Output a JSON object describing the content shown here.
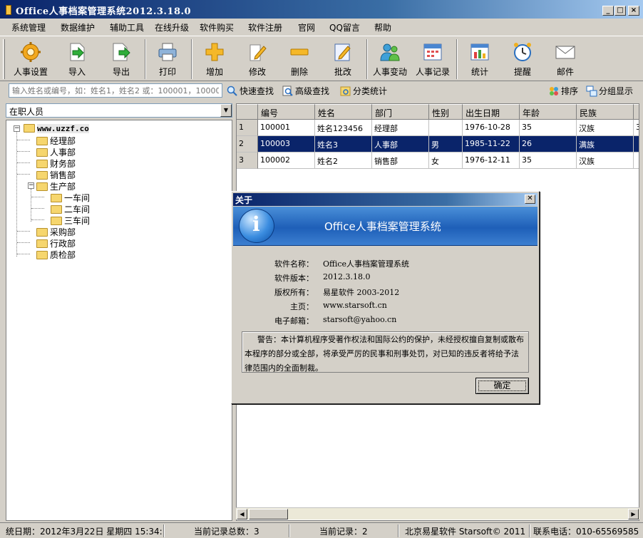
{
  "window": {
    "title": "Office人事档案管理系统2012.3.18.0",
    "controls": {
      "minimize": "_",
      "maximize": "□",
      "close": "×"
    }
  },
  "menu": [
    {
      "id": "system",
      "label": "系统管理"
    },
    {
      "id": "data",
      "label": "数据维护"
    },
    {
      "id": "tools",
      "label": "辅助工具"
    },
    {
      "id": "upgrade",
      "label": "在线升级"
    },
    {
      "id": "buy",
      "label": "软件购买"
    },
    {
      "id": "register",
      "label": "软件注册"
    },
    {
      "id": "site",
      "label": "官网"
    },
    {
      "id": "qq",
      "label": "QQ留言"
    },
    {
      "id": "help",
      "label": "帮助"
    }
  ],
  "toolbar": [
    {
      "id": "settings",
      "label": "人事设置",
      "icon": "gear-icon"
    },
    {
      "id": "import",
      "label": "导入",
      "icon": "import-icon"
    },
    {
      "id": "export",
      "label": "导出",
      "icon": "export-icon"
    },
    {
      "id": "print",
      "label": "打印",
      "icon": "printer-icon"
    },
    {
      "id": "add",
      "label": "增加",
      "icon": "plus-icon"
    },
    {
      "id": "edit",
      "label": "修改",
      "icon": "pencil-icon"
    },
    {
      "id": "delete",
      "label": "删除",
      "icon": "minus-icon"
    },
    {
      "id": "batch",
      "label": "批改",
      "icon": "batch-edit-icon"
    },
    {
      "id": "change",
      "label": "人事变动",
      "icon": "people-icon"
    },
    {
      "id": "record",
      "label": "人事记录",
      "icon": "calendar-icon"
    },
    {
      "id": "stats",
      "label": "统计",
      "icon": "bar-chart-icon"
    },
    {
      "id": "remind",
      "label": "提醒",
      "icon": "alarm-clock-icon"
    },
    {
      "id": "mail",
      "label": "邮件",
      "icon": "envelope-icon"
    }
  ],
  "search": {
    "placeholder": "输入姓名或编号，如：姓名1，姓名2 或：100001，100002",
    "quick": "快速查找",
    "advanced": "高级查找",
    "category": "分类统计",
    "sort": "排序",
    "group": "分组显示"
  },
  "filter": {
    "selected": "在职人员"
  },
  "tree": {
    "root": "www.uzzf.co",
    "departments": [
      "经理部",
      "人事部",
      "财务部",
      "销售部",
      "生产部",
      "一车间",
      "二车间",
      "三车间",
      "采购部",
      "行政部",
      "质检部"
    ]
  },
  "grid": {
    "columns": [
      "编号",
      "姓名",
      "部门",
      "性别",
      "出生日期",
      "年龄",
      "民族"
    ],
    "rows": [
      {
        "n": "1",
        "id": "100001",
        "name": "姓名123456",
        "dept": "经理部",
        "gender": "",
        "birth": "1976-10-28",
        "age": "35",
        "nation": "汉族",
        "extra": "3"
      },
      {
        "n": "2",
        "id": "100003",
        "name": "姓名3",
        "dept": "人事部",
        "gender": "男",
        "birth": "1985-11-22",
        "age": "26",
        "nation": "满族",
        "extra": ""
      },
      {
        "n": "3",
        "id": "100002",
        "name": "姓名2",
        "dept": "销售部",
        "gender": "女",
        "birth": "1976-12-11",
        "age": "35",
        "nation": "汉族",
        "extra": ""
      }
    ],
    "selected_row": 2
  },
  "dialog": {
    "title": "关于",
    "banner_title": "Office人事档案管理系统",
    "info": [
      {
        "key": "软件名称：",
        "value": "Office人事档案管理系统"
      },
      {
        "key": "软件版本：",
        "value": "2012.3.18.0"
      },
      {
        "key": "版权所有：",
        "value": "易星软件 2003-2012"
      },
      {
        "key": "主页：",
        "value": "www.starsoft.cn"
      },
      {
        "key": "电子邮箱：",
        "value": "starsoft@yahoo.cn"
      }
    ],
    "warning": "警告：本计算机程序受著作权法和国际公约的保护，未经授权擅自复制或散布本程序的部分或全部，将承受严厉的民事和刑事处罚，对已知的违反者将给予法律范围内的全面制裁。",
    "ok": "确定"
  },
  "status": {
    "date": "统日期：2012年3月22日 星期四  15:34:",
    "total": "当前记录总数：3",
    "current": "当前记录：2",
    "company": "北京易星软件 Starsoft© 2011",
    "phone": "联系电话：010-65569585"
  }
}
